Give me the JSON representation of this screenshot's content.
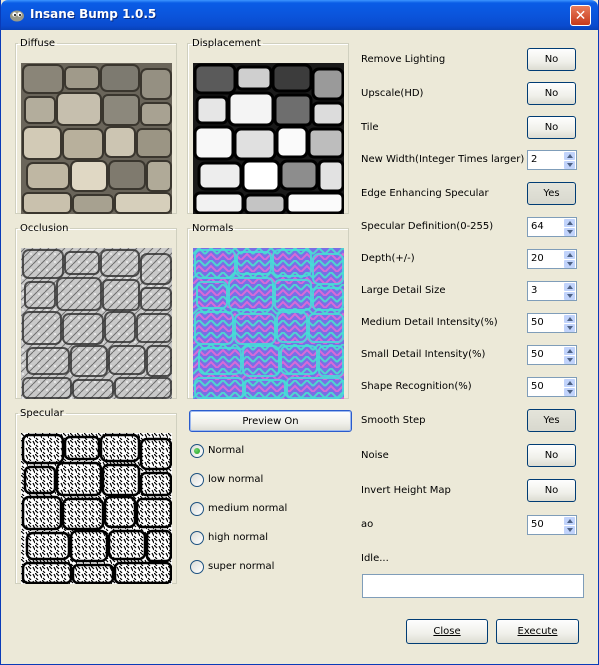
{
  "window": {
    "title": "Insane Bump 1.0.5",
    "close_glyph": "✕"
  },
  "previews": {
    "diffuse": "Diffuse",
    "displacement": "Displacement",
    "occlusion": "Occlusion",
    "normals": "Normals",
    "specular": "Specular"
  },
  "preview_button": "Preview On",
  "normal_modes": {
    "selected": "Normal",
    "options": [
      "Normal",
      "low normal",
      "medium normal",
      "high normal",
      "super normal"
    ]
  },
  "settings": {
    "remove_lighting": {
      "label": "Remove Lighting",
      "value": "No"
    },
    "upscale": {
      "label": "Upscale(HD)",
      "value": "No"
    },
    "tile": {
      "label": "Tile",
      "value": "No"
    },
    "new_width": {
      "label": "New Width(Integer Times larger)",
      "value": "2"
    },
    "edge_specular": {
      "label": "Edge Enhancing Specular",
      "value": "Yes"
    },
    "specular_definition": {
      "label": "Specular Definition(0-255)",
      "value": "64"
    },
    "depth": {
      "label": "Depth(+/-)",
      "value": "20"
    },
    "large_detail": {
      "label": "Large Detail Size",
      "value": "3"
    },
    "medium_detail": {
      "label": "Medium Detail Intensity(%)",
      "value": "50"
    },
    "small_detail": {
      "label": "Small Detail Intensity(%)",
      "value": "50"
    },
    "shape_recognition": {
      "label": "Shape Recognition(%)",
      "value": "50"
    },
    "smooth_step": {
      "label": "Smooth Step",
      "value": "Yes"
    },
    "noise": {
      "label": "Noise",
      "value": "No"
    },
    "invert_height": {
      "label": "Invert Height Map",
      "value": "No"
    },
    "ao": {
      "label": "ao",
      "value": "50"
    }
  },
  "status": {
    "text": "Idle...",
    "progress": 0
  },
  "footer": {
    "close_label": "Close",
    "execute_label": "Execute"
  },
  "colors": {
    "titlebar": "#0b55dc",
    "window_bg": "#ece9d8",
    "button_border": "#003c74",
    "normal_map": "#7a6ee6"
  }
}
